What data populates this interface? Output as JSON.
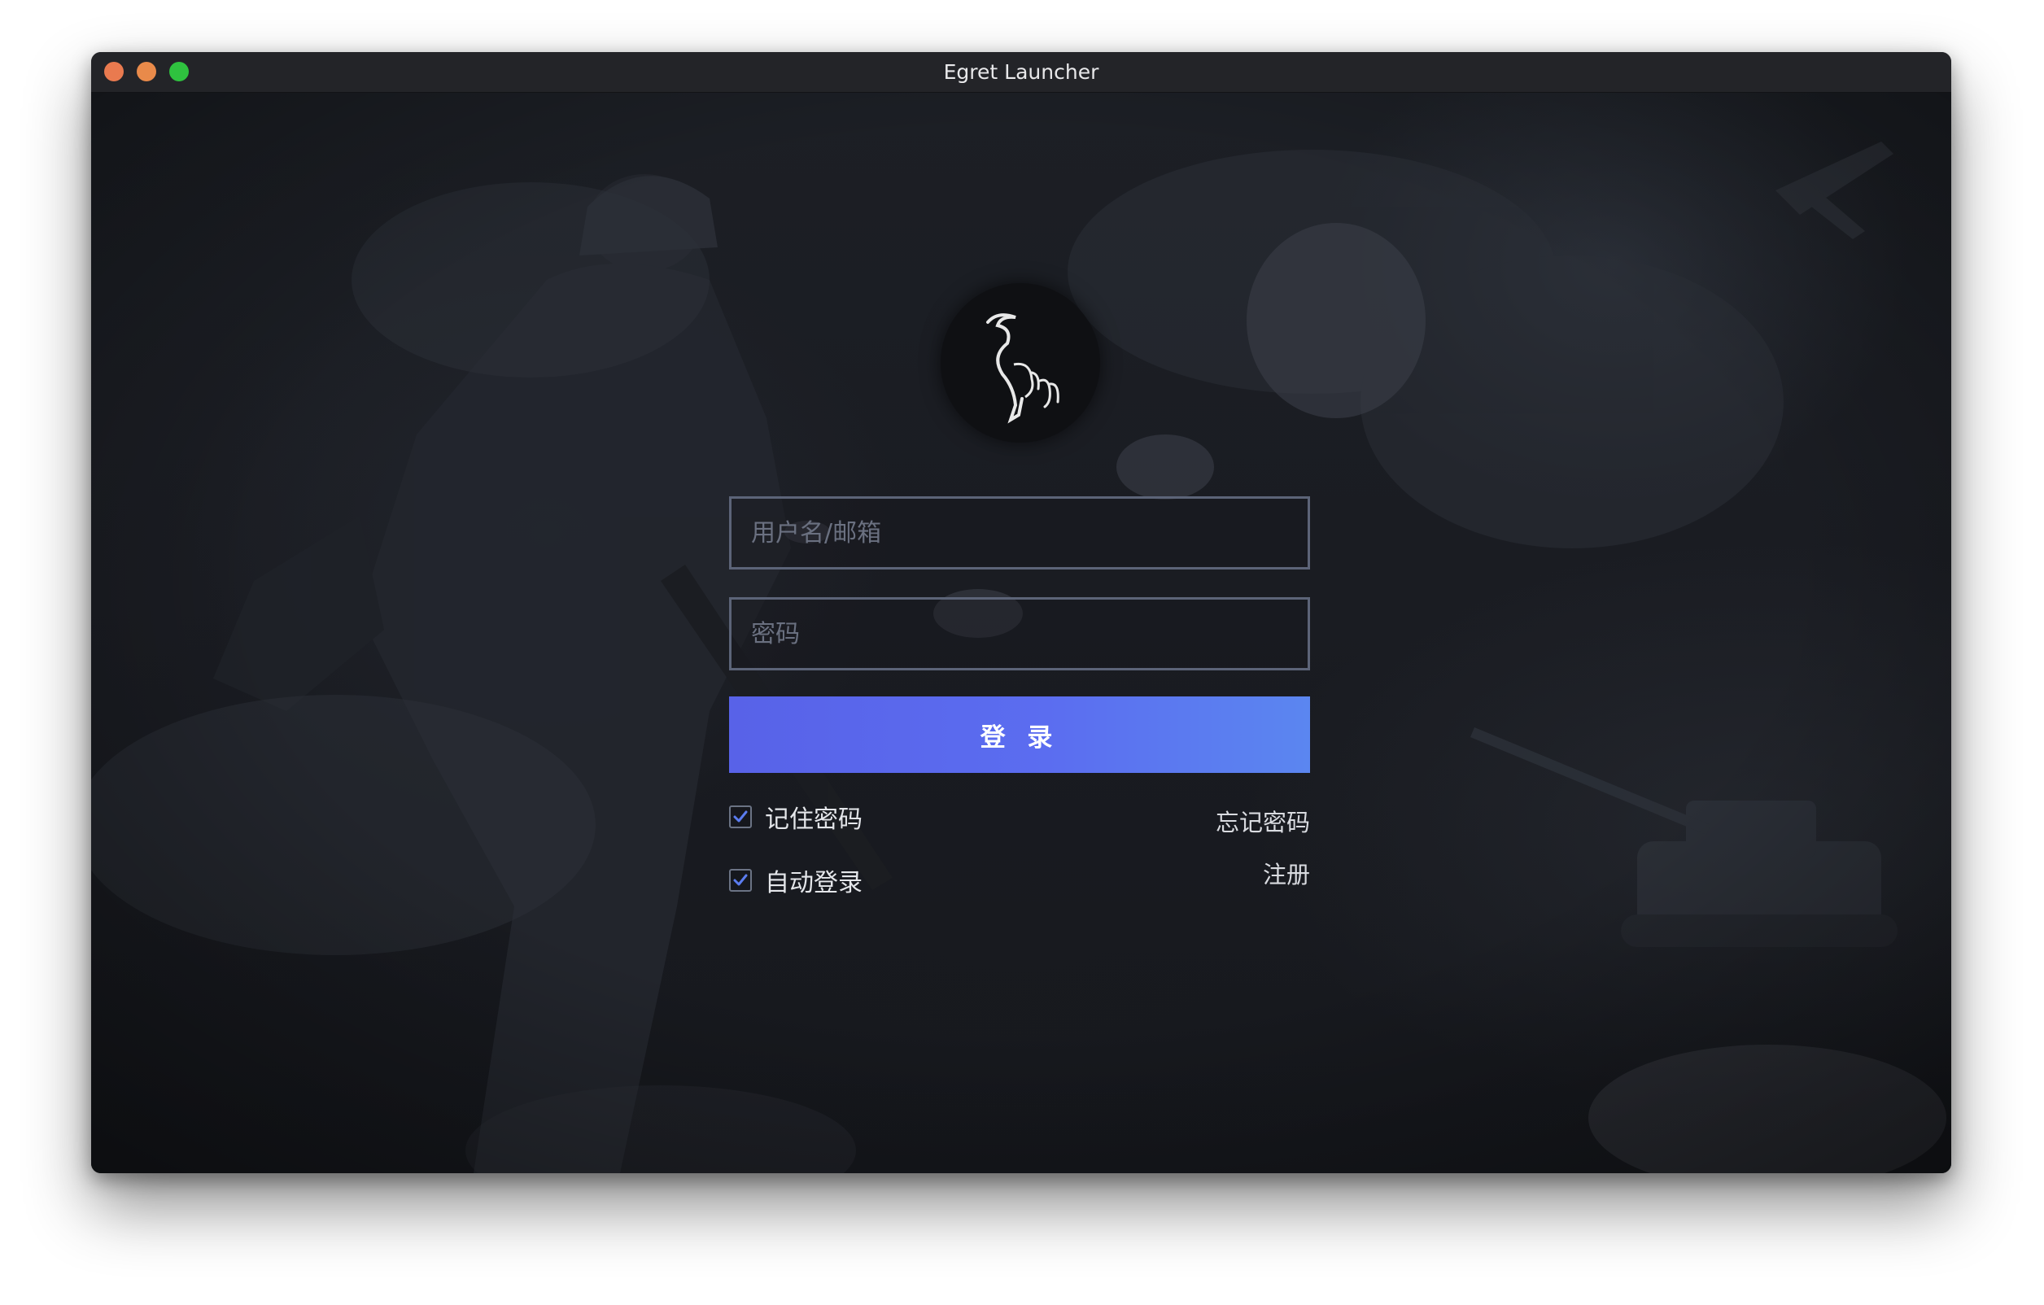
{
  "window": {
    "title": "Egret Launcher"
  },
  "logo": {
    "icon": "egret-logo-icon"
  },
  "form": {
    "username_placeholder": "用户名/邮箱",
    "username_value": "",
    "password_placeholder": "密码",
    "password_value": "",
    "login_label": "登 录",
    "remember_label": "记住密码",
    "remember_checked": true,
    "auto_login_label": "自动登录",
    "auto_login_checked": true,
    "forgot_label": "忘记密码",
    "register_label": "注册"
  },
  "colors": {
    "accent_start": "#5862e8",
    "accent_end": "#5b86f0",
    "checkmark": "#5b7cf0"
  }
}
